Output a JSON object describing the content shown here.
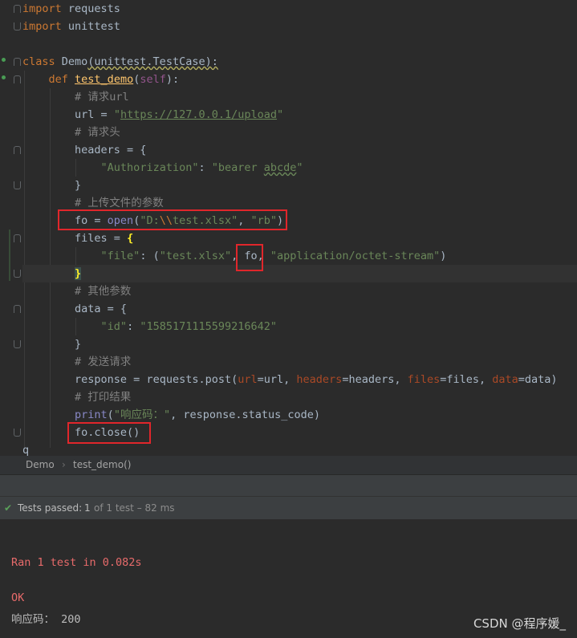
{
  "editor": {
    "l1": {
      "kw": "import",
      "rest": " requests"
    },
    "l2": {
      "kw": "import",
      "rest": " unittest"
    },
    "l4": {
      "kw": "class",
      "name": " Demo",
      "rest": "(unittest.TestCase):"
    },
    "l5": {
      "kw": "def",
      "name": "test_demo",
      "p1": "(",
      "self": "self",
      "p2": "):"
    },
    "l6": "# 请求url",
    "l7": {
      "a": "url = ",
      "q1": "\"",
      "link": "https://127.0.0.1/upload",
      "q2": "\""
    },
    "l8": "# 请求头",
    "l9": "headers = {",
    "l10": {
      "key": "\"Authorization\"",
      "mid": ": ",
      "val": "\"bearer ",
      "val2": "abcde",
      "val3": "\""
    },
    "l11": "}",
    "l12": "# 上传文件的参数",
    "l13": {
      "a": "fo = ",
      "fn": "open",
      "b": "(",
      "s1": "\"D:",
      "esc": "\\\\",
      "s2": "test.xlsx\"",
      "c": ", ",
      "s3": "\"rb\"",
      "d": ")"
    },
    "l14": {
      "a": "files = ",
      "brace": "{"
    },
    "l15": {
      "key": "\"file\"",
      "a": ": (",
      "s1": "\"test.xlsx\"",
      "b": ", ",
      "fo": "fo,",
      "c": " ",
      "s2": "\"application/octet-stream\"",
      "d": ")"
    },
    "l16": "}",
    "l17": "# 其他参数",
    "l18": "data = {",
    "l19": {
      "key": "\"id\"",
      "a": ": ",
      "val": "\"1585171115599216642\""
    },
    "l20": "}",
    "l21": "# 发送请求",
    "l22": {
      "a": "response = requests.post(",
      "p1": "url",
      "b": "=url, ",
      "p2": "headers",
      "c": "=headers, ",
      "p3": "files",
      "d": "=files, ",
      "p4": "data",
      "e": "=data)"
    },
    "l23": "# 打印结果",
    "l24": {
      "fn": "print",
      "a": "(",
      "s": "\"响应码：\"",
      "b": ", response.status_code)"
    },
    "l25": "fo.close()",
    "l26": "q"
  },
  "breadcrumb": {
    "item1": "Demo",
    "sep": "›",
    "item2": "test_demo()"
  },
  "test_status": {
    "label": "Tests passed:",
    "count": "1",
    "rest": "of 1 test – 82 ms"
  },
  "console": {
    "l1": "Ran 1 test in 0.082s",
    "l2": "OK",
    "l3": "响应码： 200"
  },
  "watermark": "CSDN @程序媛_",
  "colors": {
    "keyword": "#cc7832",
    "string": "#6a8759",
    "comment": "#808080",
    "highlight_box": "#e0262b",
    "pass": "#5aa25a"
  }
}
